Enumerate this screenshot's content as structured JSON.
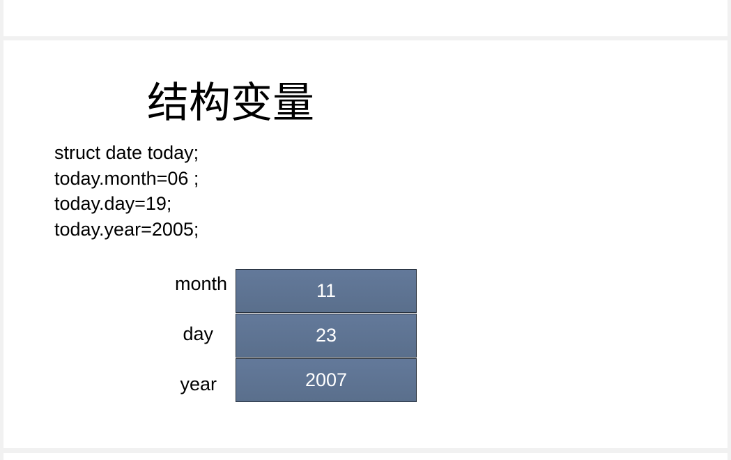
{
  "slide": {
    "title": "结构变量",
    "code_lines": [
      "struct date today;",
      "today.month=06 ;",
      "today.day=19;",
      "today.year=2005;"
    ],
    "fields": [
      {
        "label": "month",
        "value": "11"
      },
      {
        "label": "day",
        "value": "23"
      },
      {
        "label": "year",
        "value": "2007"
      }
    ]
  },
  "colors": {
    "box_fill": "#5d7391",
    "box_border": "#222a35",
    "box_text": "#ffffff",
    "background": "#f1f1f1",
    "slide": "#ffffff"
  }
}
